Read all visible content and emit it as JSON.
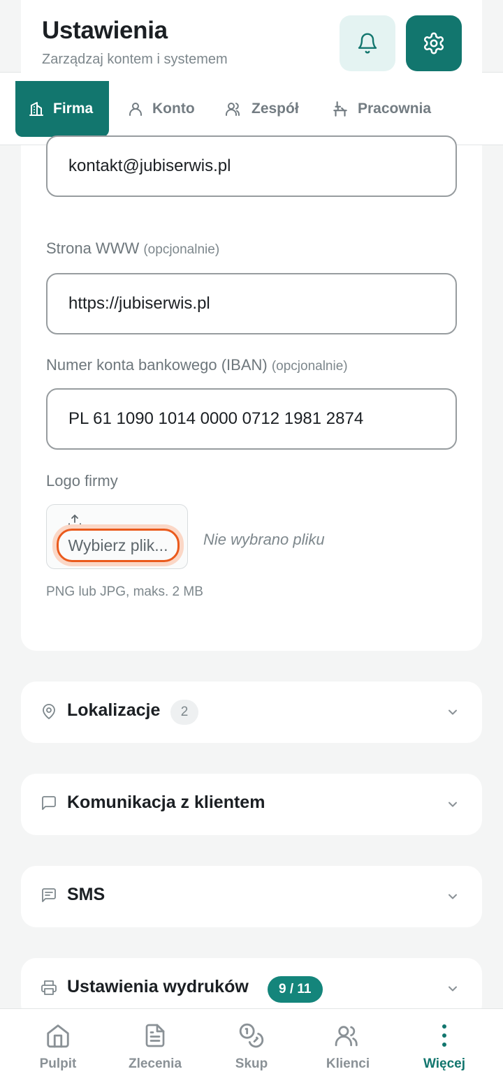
{
  "header": {
    "title": "Ustawienia",
    "subtitle": "Zarządzaj kontem i systemem",
    "notifications_icon": "bell-icon",
    "settings_icon": "gear-icon"
  },
  "tabs": [
    {
      "label": "Firma",
      "icon": "building-icon",
      "active": true
    },
    {
      "label": "Konto",
      "icon": "user-icon",
      "active": false
    },
    {
      "label": "Zespół",
      "icon": "users-icon",
      "active": false
    },
    {
      "label": "Pracownia",
      "icon": "workbench-icon",
      "active": false
    }
  ],
  "form": {
    "email_value": "kontakt@jubiserwis.pl",
    "website": {
      "label": "Strona WWW",
      "optional": "(opcjonalnie)",
      "value": "https://jubiserwis.pl"
    },
    "iban": {
      "label": "Numer konta bankowego (IBAN)",
      "optional": "(opcjonalnie)",
      "value": "PL 61 1090 1014 0000 0712 1981 2874"
    },
    "logo": {
      "label": "Logo firmy",
      "button": "Wybierz plik...",
      "status": "Nie wybrano pliku",
      "hint": "PNG lub JPG, maks. 2 MB"
    }
  },
  "sections": [
    {
      "title": "Lokalizacje",
      "icon": "map-pin-icon",
      "badge": "2"
    },
    {
      "title": "Komunikacja z klientem",
      "icon": "message-icon"
    },
    {
      "title": "SMS",
      "icon": "sms-icon"
    },
    {
      "title": "Ustawienia wydruków",
      "icon": "printer-icon",
      "badge": "9 / 11"
    }
  ],
  "bottom_nav": [
    {
      "label": "Pulpit",
      "icon": "home-icon",
      "active": false
    },
    {
      "label": "Zlecenia",
      "icon": "document-icon",
      "active": false
    },
    {
      "label": "Skup",
      "icon": "coins-icon",
      "active": false
    },
    {
      "label": "Klienci",
      "icon": "users-icon",
      "active": false
    },
    {
      "label": "Więcej",
      "icon": "more-vertical-icon",
      "active": true
    }
  ],
  "colors": {
    "accent": "#12766e",
    "accent_light": "#e4f3f2",
    "focus_ring": "#ea5a1c",
    "background": "#f4f5f5"
  }
}
